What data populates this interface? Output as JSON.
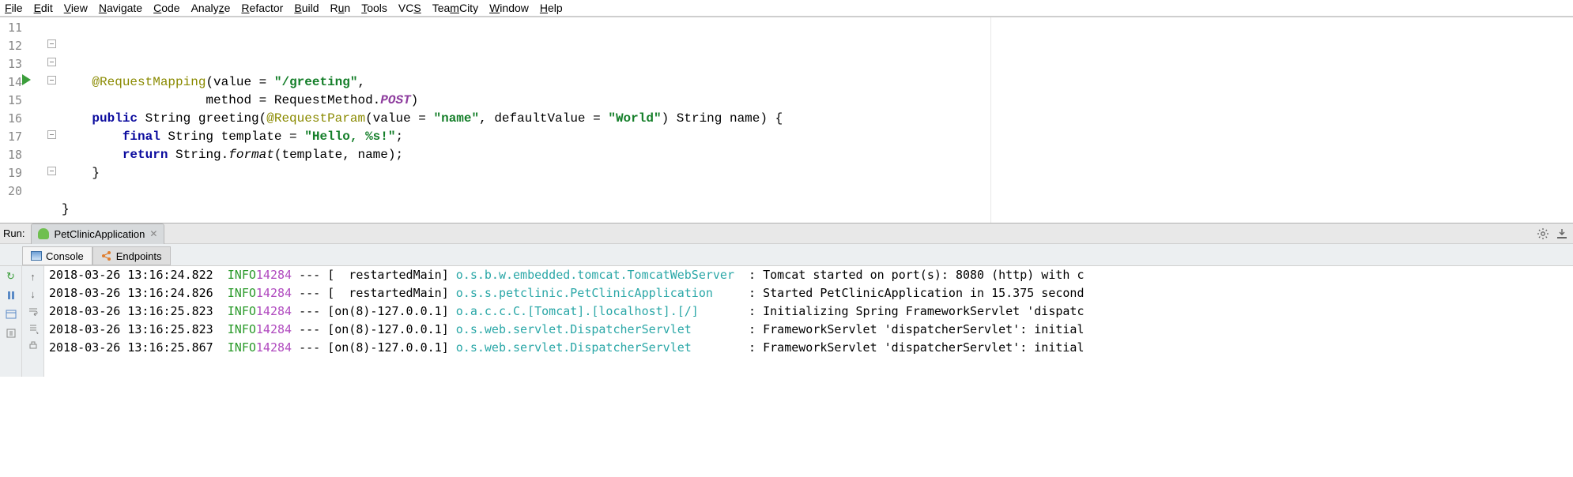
{
  "menu": {
    "file": "File",
    "edit": "Edit",
    "view": "View",
    "navigate": "Navigate",
    "code": "Code",
    "analyze": "Analyze",
    "refactor": "Refactor",
    "build": "Build",
    "run": "Run",
    "tools": "Tools",
    "vcs": "VCS",
    "teamcity": "TeamCity",
    "window": "Window",
    "help": "Help"
  },
  "editor": {
    "line_numbers": [
      "11",
      "12",
      "13",
      "14",
      "15",
      "16",
      "17",
      "18",
      "19",
      "20"
    ],
    "lines": [
      {
        "indent": "    ",
        "tokens": [
          {
            "t": "@RequestMapping",
            "c": "ann"
          },
          {
            "t": "(value = "
          },
          {
            "t": "\"/greeting\"",
            "c": "str"
          },
          {
            "t": ","
          }
        ]
      },
      {
        "indent": "                   ",
        "tokens": [
          {
            "t": "method = RequestMethod."
          },
          {
            "t": "POST",
            "c": "em"
          },
          {
            "t": ")"
          }
        ]
      },
      {
        "indent": "    ",
        "tokens": [
          {
            "t": "public ",
            "c": "kw"
          },
          {
            "t": "String greeting("
          },
          {
            "t": "@RequestParam",
            "c": "ann"
          },
          {
            "t": "(value = "
          },
          {
            "t": "\"name\"",
            "c": "str"
          },
          {
            "t": ", defaultValue = "
          },
          {
            "t": "\"World\"",
            "c": "str"
          },
          {
            "t": ") String name) {"
          }
        ]
      },
      {
        "indent": "        ",
        "tokens": [
          {
            "t": "final ",
            "c": "kw"
          },
          {
            "t": "String template = "
          },
          {
            "t": "\"Hello, %s!\"",
            "c": "str"
          },
          {
            "t": ";"
          }
        ]
      },
      {
        "indent": "        ",
        "tokens": [
          {
            "t": "return ",
            "c": "kw"
          },
          {
            "t": "String."
          },
          {
            "t": "format",
            "c": "it"
          },
          {
            "t": "(template, name);"
          }
        ]
      },
      {
        "indent": "    ",
        "tokens": [
          {
            "t": "}"
          }
        ]
      },
      {
        "indent": "",
        "tokens": [],
        "current": true
      },
      {
        "indent": "",
        "tokens": [
          {
            "t": "}"
          }
        ]
      },
      {
        "indent": "",
        "tokens": []
      }
    ]
  },
  "run": {
    "label": "Run:",
    "tab_name": "PetClinicApplication",
    "subtabs": {
      "console": "Console",
      "endpoints": "Endpoints"
    },
    "log_lines": [
      {
        "ts": "2018-03-26 13:16:24.822",
        "lvl": "INFO",
        "pid": "14284",
        "thread": "[  restartedMain]",
        "logger": "o.s.b.w.embedded.tomcat.TomcatWebServer",
        "msg": ": Tomcat started on port(s): 8080 (http) with c"
      },
      {
        "ts": "2018-03-26 13:16:24.826",
        "lvl": "INFO",
        "pid": "14284",
        "thread": "[  restartedMain]",
        "logger": "o.s.s.petclinic.PetClinicApplication",
        "msg": ": Started PetClinicApplication in 15.375 second"
      },
      {
        "ts": "2018-03-26 13:16:25.823",
        "lvl": "INFO",
        "pid": "14284",
        "thread": "[on(8)-127.0.0.1]",
        "logger": "o.a.c.c.C.[Tomcat].[localhost].[/]",
        "msg": ": Initializing Spring FrameworkServlet 'dispatc"
      },
      {
        "ts": "2018-03-26 13:16:25.823",
        "lvl": "INFO",
        "pid": "14284",
        "thread": "[on(8)-127.0.0.1]",
        "logger": "o.s.web.servlet.DispatcherServlet",
        "msg": ": FrameworkServlet 'dispatcherServlet': initial"
      },
      {
        "ts": "2018-03-26 13:16:25.867",
        "lvl": "INFO",
        "pid": "14284",
        "thread": "[on(8)-127.0.0.1]",
        "logger": "o.s.web.servlet.DispatcherServlet",
        "msg": ": FrameworkServlet 'dispatcherServlet': initial"
      }
    ]
  }
}
